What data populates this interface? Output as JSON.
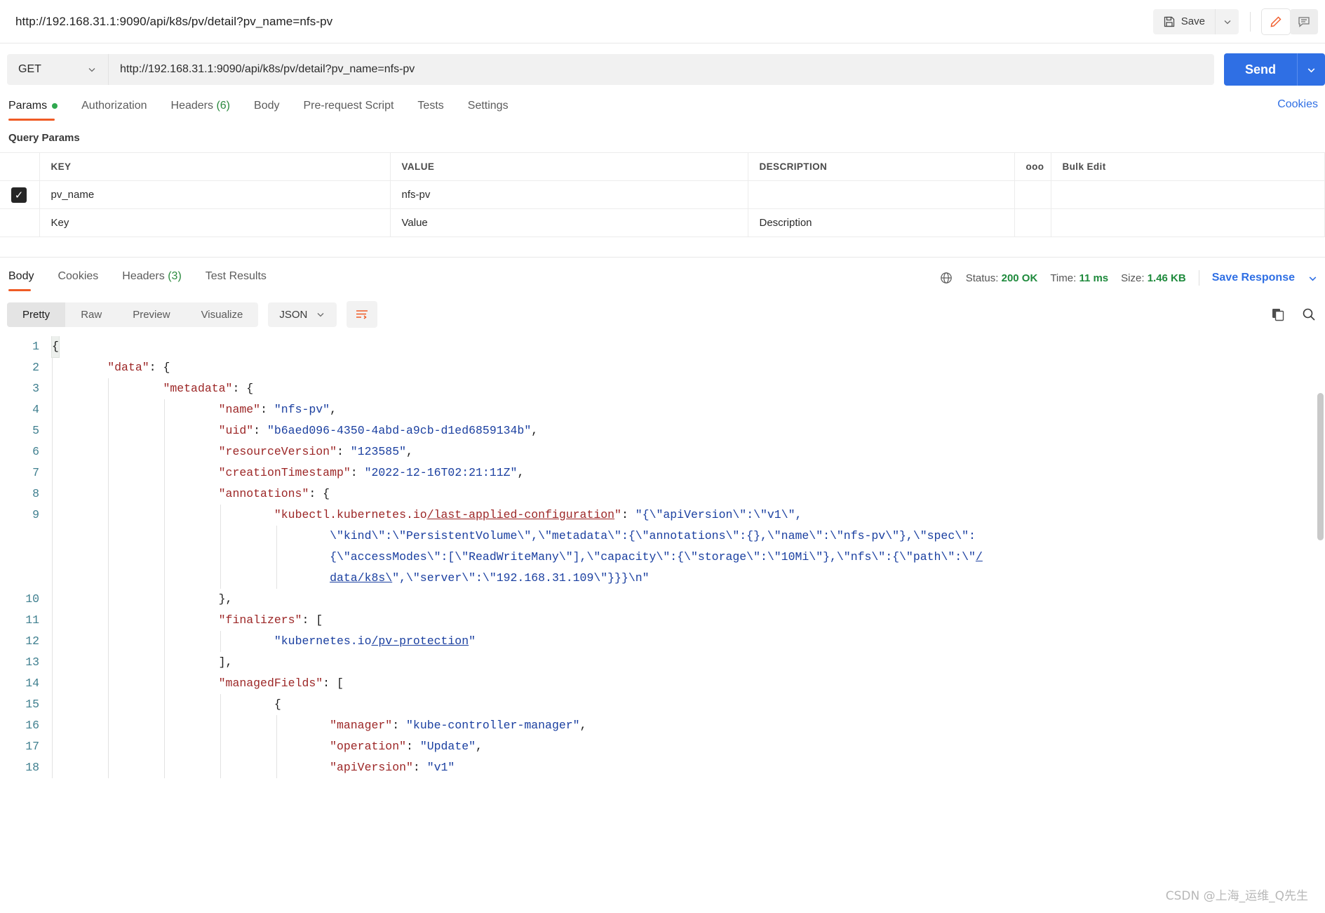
{
  "window": {
    "request_title": "http://192.168.31.1:9090/api/k8s/pv/detail?pv_name=nfs-pv",
    "save_label": "Save",
    "save_icon": "floppy-disk-icon",
    "save_caret_icon": "chevron-down-icon",
    "edit_icon": "pencil-icon",
    "comment_icon": "comment-icon"
  },
  "request": {
    "method": "GET",
    "method_caret_icon": "chevron-down-icon",
    "url": "http://192.168.31.1:9090/api/k8s/pv/detail?pv_name=nfs-pv",
    "send_label": "Send",
    "send_caret_icon": "chevron-down-icon"
  },
  "request_tabs": [
    {
      "label": "Params",
      "badge": "",
      "active": true,
      "dot": true
    },
    {
      "label": "Authorization",
      "badge": "",
      "active": false,
      "dot": false
    },
    {
      "label": "Headers",
      "badge": "(6)",
      "active": false,
      "dot": false
    },
    {
      "label": "Body",
      "badge": "",
      "active": false,
      "dot": false
    },
    {
      "label": "Pre-request Script",
      "badge": "",
      "active": false,
      "dot": false
    },
    {
      "label": "Tests",
      "badge": "",
      "active": false,
      "dot": false
    },
    {
      "label": "Settings",
      "badge": "",
      "active": false,
      "dot": false
    }
  ],
  "cookies_link": "Cookies",
  "query_params": {
    "section_label": "Query Params",
    "columns": [
      "KEY",
      "VALUE",
      "DESCRIPTION"
    ],
    "more_icon": "ooo",
    "bulk_edit_label": "Bulk Edit",
    "rows": [
      {
        "checked": true,
        "key": "pv_name",
        "value": "nfs-pv",
        "description": ""
      }
    ],
    "placeholders": {
      "key": "Key",
      "value": "Value",
      "description": "Description"
    }
  },
  "response": {
    "tabs": [
      {
        "label": "Body",
        "badge": "",
        "active": true
      },
      {
        "label": "Cookies",
        "badge": "",
        "active": false
      },
      {
        "label": "Headers",
        "badge": "(3)",
        "active": false
      },
      {
        "label": "Test Results",
        "badge": "",
        "active": false
      }
    ],
    "globe_icon": "globe-icon",
    "status_label": "Status:",
    "status_value": "200 OK",
    "time_label": "Time:",
    "time_value": "11 ms",
    "size_label": "Size:",
    "size_value": "1.46 KB",
    "save_response_label": "Save Response",
    "save_response_caret_icon": "chevron-down-icon",
    "view_modes": [
      {
        "label": "Pretty",
        "active": true
      },
      {
        "label": "Raw",
        "active": false
      },
      {
        "label": "Preview",
        "active": false
      },
      {
        "label": "Visualize",
        "active": false
      }
    ],
    "format": "JSON",
    "format_caret_icon": "chevron-down-icon",
    "wrap_icon": "word-wrap-icon",
    "copy_icon": "copy-icon",
    "search_icon": "search-icon"
  },
  "code_lines": [
    {
      "n": "1",
      "segments": [
        {
          "t": "{",
          "c": "p",
          "box": true
        }
      ],
      "indent": 0
    },
    {
      "n": "2",
      "segments": [
        {
          "t": "\"data\"",
          "c": "k"
        },
        {
          "t": ": {",
          "c": "p"
        }
      ],
      "indent": 1
    },
    {
      "n": "3",
      "segments": [
        {
          "t": "\"metadata\"",
          "c": "k"
        },
        {
          "t": ": {",
          "c": "p"
        }
      ],
      "indent": 2
    },
    {
      "n": "4",
      "segments": [
        {
          "t": "\"name\"",
          "c": "k"
        },
        {
          "t": ": ",
          "c": "p"
        },
        {
          "t": "\"nfs-pv\"",
          "c": "s"
        },
        {
          "t": ",",
          "c": "p"
        }
      ],
      "indent": 3
    },
    {
      "n": "5",
      "segments": [
        {
          "t": "\"uid\"",
          "c": "k"
        },
        {
          "t": ": ",
          "c": "p"
        },
        {
          "t": "\"b6aed096-4350-4abd-a9cb-d1ed6859134b\"",
          "c": "s"
        },
        {
          "t": ",",
          "c": "p"
        }
      ],
      "indent": 3
    },
    {
      "n": "6",
      "segments": [
        {
          "t": "\"resourceVersion\"",
          "c": "k"
        },
        {
          "t": ": ",
          "c": "p"
        },
        {
          "t": "\"123585\"",
          "c": "s"
        },
        {
          "t": ",",
          "c": "p"
        }
      ],
      "indent": 3
    },
    {
      "n": "7",
      "segments": [
        {
          "t": "\"creationTimestamp\"",
          "c": "k"
        },
        {
          "t": ": ",
          "c": "p"
        },
        {
          "t": "\"2022-12-16T02:21:11Z\"",
          "c": "s"
        },
        {
          "t": ",",
          "c": "p"
        }
      ],
      "indent": 3
    },
    {
      "n": "8",
      "segments": [
        {
          "t": "\"annotations\"",
          "c": "k"
        },
        {
          "t": ": {",
          "c": "p"
        }
      ],
      "indent": 3
    },
    {
      "n": "9",
      "segments": [
        {
          "t": "\"kubectl.kubernetes.io",
          "c": "k"
        },
        {
          "t": "/last-applied-configuration",
          "c": "k",
          "ul": true
        },
        {
          "t": "\"",
          "c": "k"
        },
        {
          "t": ": ",
          "c": "p"
        },
        {
          "t": "\"{\\\"apiVersion\\\":\\\"v1\\\",",
          "c": "s"
        }
      ],
      "indent": 4
    },
    {
      "n": "",
      "segments": [
        {
          "t": "\\\"kind\\\":\\\"PersistentVolume\\\",\\\"metadata\\\":{\\\"annotations\\\":{},\\\"name\\\":\\\"nfs-pv\\\"},\\\"spec\\\":",
          "c": "s"
        }
      ],
      "indent": 5
    },
    {
      "n": "",
      "segments": [
        {
          "t": "{\\\"accessModes\\\":[\\\"ReadWriteMany\\\"],\\\"capacity\\\":{\\\"storage\\\":\\\"10Mi\\\"},\\\"nfs\\\":{\\\"path\\\":\\\"",
          "c": "s"
        },
        {
          "t": "/",
          "c": "s",
          "ul": true
        }
      ],
      "indent": 5
    },
    {
      "n": "",
      "segments": [
        {
          "t": "data/k8s\\",
          "c": "s",
          "ul": true
        },
        {
          "t": "\",\\\"server\\\":\\\"192.168.31.109\\\"}}}\\n\"",
          "c": "s"
        }
      ],
      "indent": 5
    },
    {
      "n": "10",
      "segments": [
        {
          "t": "},",
          "c": "p"
        }
      ],
      "indent": 3
    },
    {
      "n": "11",
      "segments": [
        {
          "t": "\"finalizers\"",
          "c": "k"
        },
        {
          "t": ": [",
          "c": "p"
        }
      ],
      "indent": 3
    },
    {
      "n": "12",
      "segments": [
        {
          "t": "\"kubernetes.io",
          "c": "s"
        },
        {
          "t": "/pv-protection",
          "c": "s",
          "ul": true
        },
        {
          "t": "\"",
          "c": "s"
        }
      ],
      "indent": 4
    },
    {
      "n": "13",
      "segments": [
        {
          "t": "],",
          "c": "p"
        }
      ],
      "indent": 3
    },
    {
      "n": "14",
      "segments": [
        {
          "t": "\"managedFields\"",
          "c": "k"
        },
        {
          "t": ": [",
          "c": "p"
        }
      ],
      "indent": 3
    },
    {
      "n": "15",
      "segments": [
        {
          "t": "{",
          "c": "p"
        }
      ],
      "indent": 4
    },
    {
      "n": "16",
      "segments": [
        {
          "t": "\"manager\"",
          "c": "k"
        },
        {
          "t": ": ",
          "c": "p"
        },
        {
          "t": "\"kube-controller-manager\"",
          "c": "s"
        },
        {
          "t": ",",
          "c": "p"
        }
      ],
      "indent": 5
    },
    {
      "n": "17",
      "segments": [
        {
          "t": "\"operation\"",
          "c": "k"
        },
        {
          "t": ": ",
          "c": "p"
        },
        {
          "t": "\"Update\"",
          "c": "s"
        },
        {
          "t": ",",
          "c": "p"
        }
      ],
      "indent": 5
    },
    {
      "n": "18",
      "segments": [
        {
          "t": "\"apiVersion\"",
          "c": "k"
        },
        {
          "t": ": ",
          "c": "p"
        },
        {
          "t": "\"v1\"",
          "c": "s"
        }
      ],
      "indent": 5
    }
  ],
  "watermark": "CSDN @上海_运维_Q先生"
}
